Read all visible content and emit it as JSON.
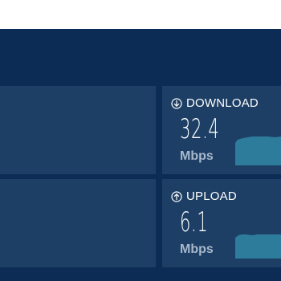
{
  "download": {
    "label": "DOWNLOAD",
    "value": "32.4",
    "unit": "Mbps",
    "icon": "arrow-down-circle-icon"
  },
  "upload": {
    "label": "UPLOAD",
    "value": "6.1",
    "unit": "Mbps",
    "icon": "arrow-up-circle-icon"
  },
  "colors": {
    "background": "#0c2c55",
    "panel": "#1e3f65",
    "sparkline": "#2e7c9c",
    "unit_text": "#a7b8cc"
  }
}
